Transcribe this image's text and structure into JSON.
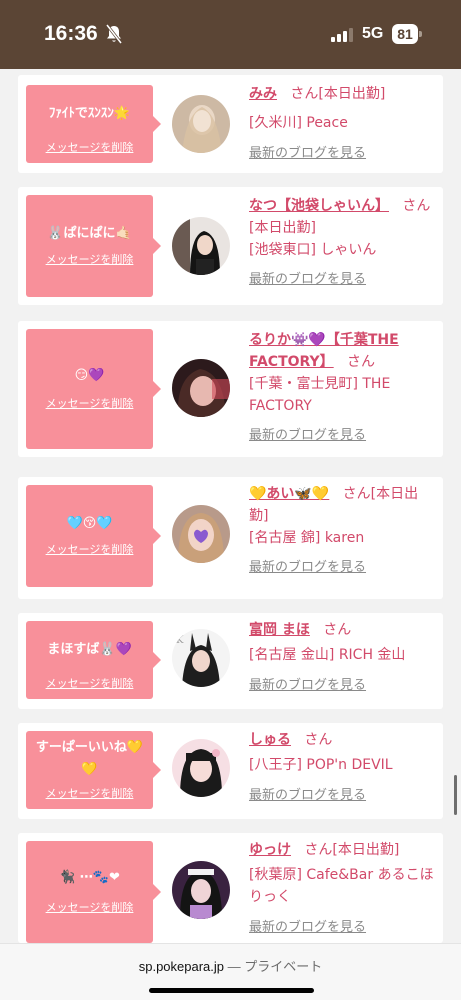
{
  "status": {
    "time": "16:36",
    "network": "5G",
    "battery": "81"
  },
  "cards": [
    {
      "message": "ﾌｧｲﾄでｽﾝｽﾝ🌟",
      "delete": "メッセージを削除",
      "name": "みみ",
      "san": "さん",
      "detail": "[本日出勤]",
      "shop": "[久米川] Peace",
      "blog": "最新のブログを見る"
    },
    {
      "message": "🐰ぱにぱに🤙🏻",
      "delete": "メッセージを削除",
      "name": "なつ【池袋しゃいん】",
      "san": "さん",
      "detail": "[本日出勤]",
      "shop": "[池袋東口] しゃいん",
      "blog": "最新のブログを見る"
    },
    {
      "message": "😏💜",
      "delete": "メッセージを削除",
      "name": "るりか👾💜【千葉THE FACTORY】",
      "san": "さん",
      "detail": "",
      "shop": "[千葉・富士見町] THE FACTORY",
      "blog": "最新のブログを見る"
    },
    {
      "message": "🩵😚🩵",
      "delete": "メッセージを削除",
      "name": "💛あい🦋💛",
      "san": "さん",
      "detail": "[本日出勤]",
      "shop": "[名古屋 錦] karen",
      "blog": "最新のブログを見る"
    },
    {
      "message": "まほすば🐰💜",
      "delete": "メッセージを削除",
      "name": "富岡 まほ",
      "san": "さん",
      "detail": "",
      "shop": "[名古屋 金山] RICH 金山",
      "blog": "最新のブログを見る"
    },
    {
      "message": "すーぱーいいね💛💛",
      "delete": "メッセージを削除",
      "name": "しゅる",
      "san": "さん",
      "detail": "",
      "shop": "[八王子] POP'n DEVIL",
      "blog": "最新のブログを見る"
    },
    {
      "message": "🐈‍⬛ ⋯🐾❤",
      "delete": "メッセージを削除",
      "name": "ゆっけ",
      "san": "さん",
      "detail": "[本日出勤]",
      "shop": "[秋葉原] Cafe&Bar あるこほりっく",
      "blog": "最新のブログを見る"
    }
  ],
  "browser": {
    "domain": "sp.pokepara.jp",
    "sep": " — ",
    "mode": "プライベート"
  }
}
